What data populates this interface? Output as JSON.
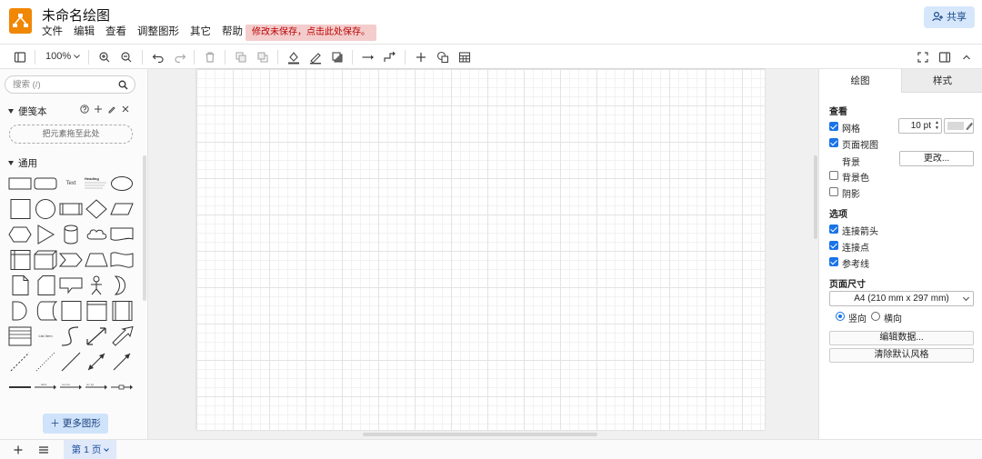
{
  "app": {
    "title": "未命名绘图",
    "unsaved_notice": "修改未保存，点击此处保存。",
    "share_label": "共享",
    "accent_color": "#f08705"
  },
  "menu": [
    "文件",
    "编辑",
    "查看",
    "调整图形",
    "其它",
    "帮助"
  ],
  "toolbar": {
    "zoom": "100%",
    "icons": [
      "format-panel-icon",
      "zoom-in-icon",
      "zoom-out-icon",
      "undo-icon",
      "redo-icon",
      "delete-icon",
      "to-front-icon",
      "to-back-icon",
      "fill-color-icon",
      "line-color-icon",
      "shadow-icon",
      "connection-icon",
      "waypoints-icon",
      "insert-icon",
      "shapes-icon",
      "table-icon",
      "fullscreen-icon",
      "toggle-panel-icon",
      "collapse-icon"
    ]
  },
  "sidebar": {
    "search_placeholder": "搜索 (/)",
    "scratchpad_title": "便笺本",
    "dropzone_text": "把元素拖至此处",
    "general_title": "通用",
    "shape_text_label": "Text",
    "shape_heading_label": "Heading",
    "shape_list_label": "List Item",
    "more_shapes_label": "更多图形"
  },
  "format_panel": {
    "tab_diagram": "绘图",
    "tab_style": "样式",
    "view_section": "查看",
    "grid_label": "网格",
    "grid_checked": true,
    "grid_size": "10 pt",
    "page_view_label": "页面视图",
    "page_view_checked": true,
    "background_label": "背景",
    "change_button": "更改...",
    "background_color_label": "背景色",
    "background_color_checked": false,
    "shadow_label": "阴影",
    "shadow_checked": false,
    "options_section": "选项",
    "connection_arrows_label": "连接箭头",
    "connection_points_label": "连接点",
    "guides_label": "参考线",
    "paper_size_section": "页面尺寸",
    "paper_size_value": "A4 (210 mm x 297 mm)",
    "portrait_label": "竖向",
    "landscape_label": "横向",
    "edit_data_button": "编辑数据...",
    "clear_style_button": "清除默认风格"
  },
  "bottom_bar": {
    "page_tab_label": "第 1 页"
  }
}
